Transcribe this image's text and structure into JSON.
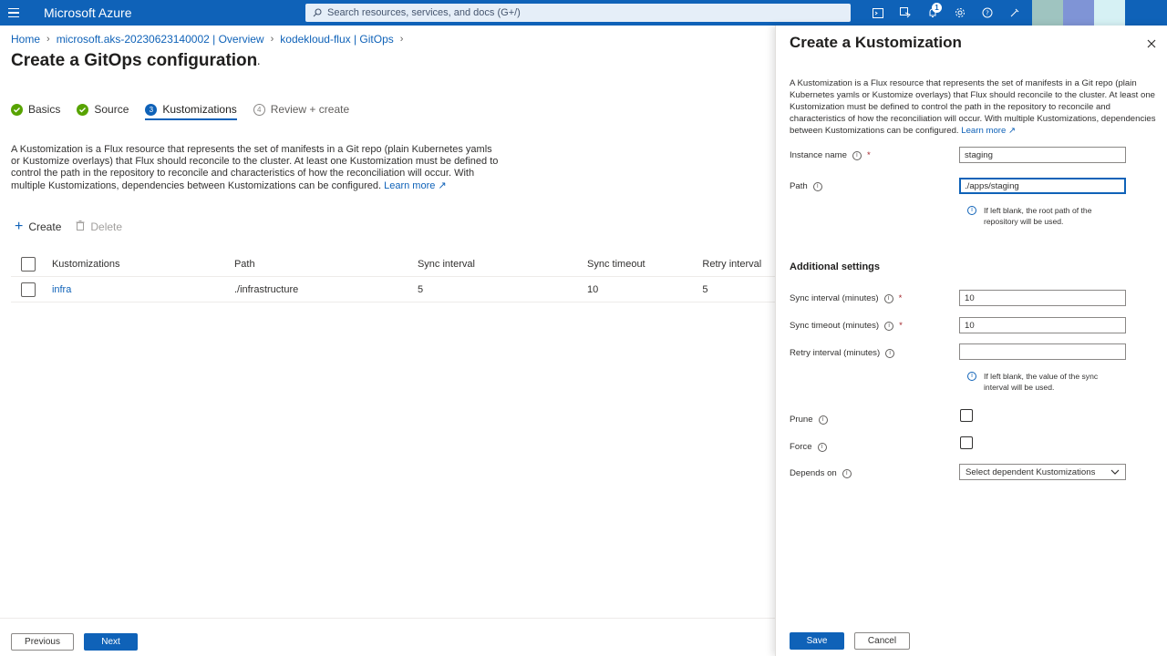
{
  "topbar": {
    "brand": "Microsoft Azure",
    "search_placeholder": "Search resources, services, and docs (G+/)",
    "notification_count": "1"
  },
  "breadcrumb": [
    "Home",
    "microsoft.aks-20230623140002 | Overview",
    "kodekloud-flux | GitOps"
  ],
  "page": {
    "title": "Create a GitOps configuration",
    "more": "..."
  },
  "tabs": [
    {
      "label": "Basics",
      "state": "done"
    },
    {
      "label": "Source",
      "state": "done"
    },
    {
      "label": "Kustomizations",
      "state": "current",
      "num": "3"
    },
    {
      "label": "Review + create",
      "state": "future",
      "num": "4"
    }
  ],
  "description": "A Kustomization is a Flux resource that represents the set of manifests in a Git repo (plain Kubernetes yamls or Kustomize overlays) that Flux should reconcile to the cluster. At least one Kustomization must be defined to control the path in the repository to reconcile and characteristics of how the reconciliation will occur. With multiple Kustomizations, dependencies between Kustomizations can be configured.",
  "learn_more": "Learn more",
  "actions": {
    "create": "Create",
    "delete": "Delete"
  },
  "table": {
    "headers": [
      "Kustomizations",
      "Path",
      "Sync interval",
      "Sync timeout",
      "Retry interval"
    ],
    "rows": [
      {
        "name": "infra",
        "path": "./infrastructure",
        "sync": "5",
        "timeout": "10",
        "retry": "5"
      }
    ]
  },
  "footer": {
    "previous": "Previous",
    "next": "Next"
  },
  "panel": {
    "title": "Create a Kustomization",
    "description": "A Kustomization is a Flux resource that represents the set of manifests in a Git repo (plain Kubernetes yamls or Kustomize overlays) that Flux should reconcile to the cluster. At least one Kustomization must be defined to control the path in the repository to reconcile and characteristics of how the reconciliation will occur. With multiple Kustomizations, dependencies between Kustomizations can be configured.",
    "learn_more": "Learn more",
    "instance_name_label": "Instance name",
    "instance_name_value": "staging",
    "path_label": "Path",
    "path_value": "./apps/staging",
    "path_hint": "If left blank, the root path of the repository will be used.",
    "additional_settings": "Additional settings",
    "sync_interval_label": "Sync interval (minutes)",
    "sync_interval_value": "10",
    "sync_timeout_label": "Sync timeout (minutes)",
    "sync_timeout_value": "10",
    "retry_interval_label": "Retry interval (minutes)",
    "retry_interval_value": "",
    "retry_hint": "If left blank, the value of the sync interval will be used.",
    "prune_label": "Prune",
    "force_label": "Force",
    "depends_on_label": "Depends on",
    "depends_on_placeholder": "Select dependent Kustomizations",
    "save": "Save",
    "cancel": "Cancel"
  },
  "colors": {
    "accent": "#0f62b8",
    "success": "#57a300"
  }
}
